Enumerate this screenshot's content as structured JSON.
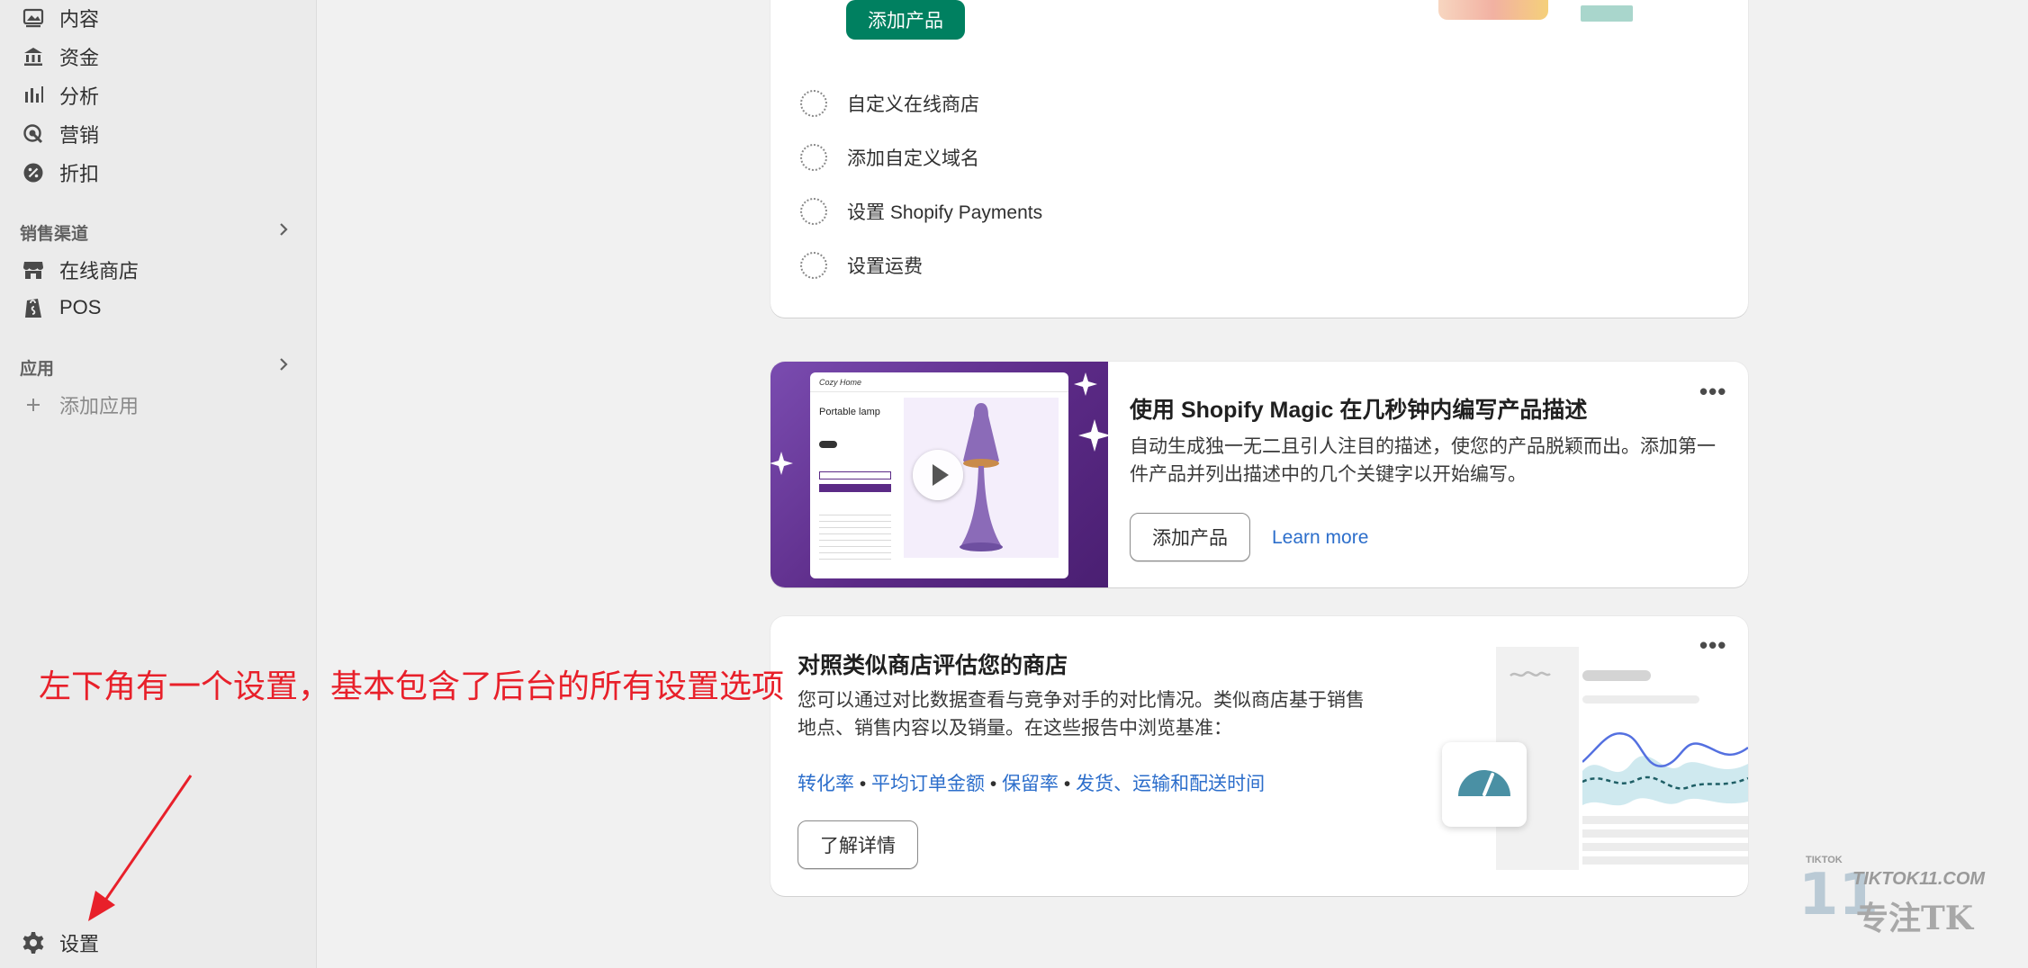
{
  "sidebar": {
    "items": [
      {
        "label": "内容",
        "icon": "content-icon"
      },
      {
        "label": "资金",
        "icon": "bank-icon"
      },
      {
        "label": "分析",
        "icon": "analytics-icon"
      },
      {
        "label": "营销",
        "icon": "marketing-icon"
      },
      {
        "label": "折扣",
        "icon": "discount-icon"
      }
    ],
    "sales_channels": {
      "heading": "销售渠道",
      "items": [
        {
          "label": "在线商店",
          "icon": "store-icon"
        },
        {
          "label": "POS",
          "icon": "pos-icon"
        }
      ]
    },
    "apps": {
      "heading": "应用",
      "add_label": "添加应用"
    },
    "settings_label": "设置"
  },
  "setup_card": {
    "add_product_button": "添加产品",
    "tasks": [
      "自定义在线商店",
      "添加自定义域名",
      "设置 Shopify Payments",
      "设置运费"
    ]
  },
  "magic_card": {
    "title": "使用 Shopify Magic 在几秒钟内编写产品描述",
    "body": "自动生成独一无二且引人注目的描述，使您的产品脱颖而出。添加第一件产品并列出描述中的几个关键字以开始编写。",
    "button": "添加产品",
    "link": "Learn more",
    "preview": {
      "store_name": "Cozy Home",
      "product_name": "Portable lamp"
    }
  },
  "benchmark_card": {
    "title": "对照类似商店评估您的商店",
    "body": "您可以通过对比数据查看与竞争对手的对比情况。类似商店基于销售地点、销售内容以及销量。在这些报告中浏览基准：",
    "metrics": [
      "转化率",
      "平均订单金额",
      "保留率",
      "发货、运输和配送时间"
    ],
    "separator": " • ",
    "button": "了解详情"
  },
  "annotation": {
    "text": "左下角有一个设置，基本包含了后台的所有设置选项",
    "color": "#e8202a"
  },
  "watermark": {
    "small": "TIKTOK",
    "domain": "TIKTOK11.COM",
    "tagline": "专注TK",
    "numeral": "11"
  },
  "colors": {
    "accent_green": "#008060",
    "link_blue": "#2c6ecb",
    "magic_purple": "#5b2a86"
  }
}
